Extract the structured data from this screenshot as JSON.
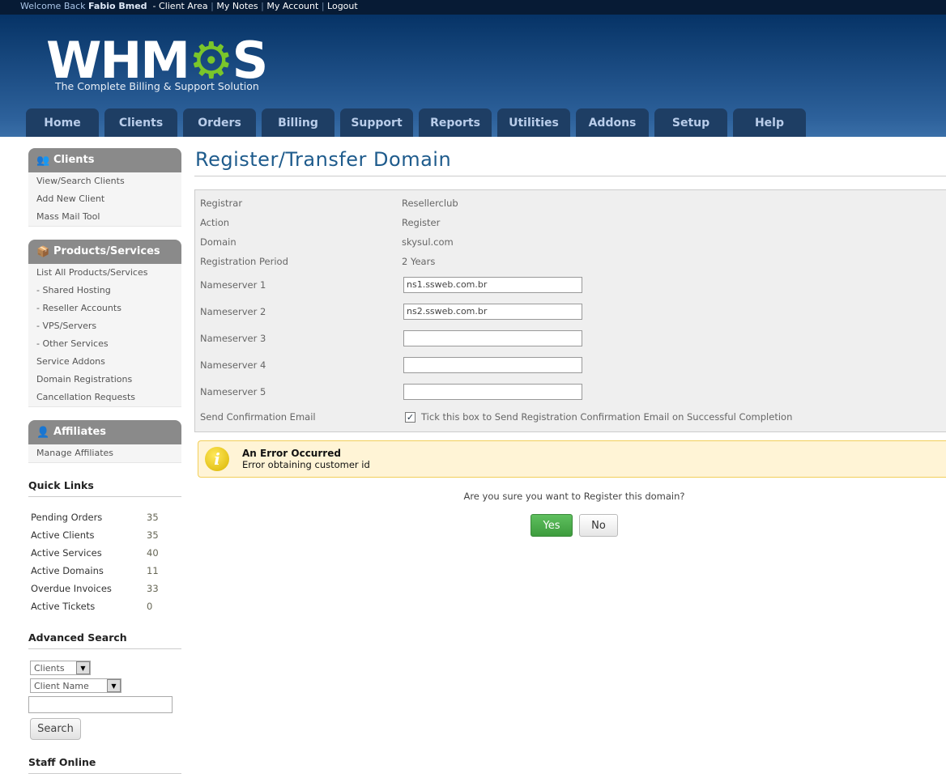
{
  "topbar": {
    "welcome": "Welcome Back",
    "user": "Fabio Bmed",
    "client_area": "Client Area",
    "my_notes": "My Notes",
    "my_account": "My Account",
    "logout": "Logout"
  },
  "logo": {
    "text": "WHMCS",
    "tagline": "The Complete Billing & Support Solution"
  },
  "nav": [
    "Home",
    "Clients",
    "Orders",
    "Billing",
    "Support",
    "Reports",
    "Utilities",
    "Addons",
    "Setup",
    "Help"
  ],
  "sidebar": {
    "clients": {
      "title": "Clients",
      "items": [
        "View/Search Clients",
        "Add New Client",
        "Mass Mail Tool"
      ]
    },
    "products": {
      "title": "Products/Services",
      "items": [
        "List All Products/Services",
        "- Shared Hosting",
        "- Reseller Accounts",
        "- VPS/Servers",
        "- Other Services",
        "Service Addons",
        "Domain Registrations",
        "Cancellation Requests"
      ]
    },
    "affiliates": {
      "title": "Affiliates",
      "items": [
        "Manage Affiliates"
      ]
    },
    "quick_links": {
      "title": "Quick Links",
      "items": [
        {
          "label": "Pending Orders",
          "count": "35"
        },
        {
          "label": "Active Clients",
          "count": "35"
        },
        {
          "label": "Active Services",
          "count": "40"
        },
        {
          "label": "Active Domains",
          "count": "11"
        },
        {
          "label": "Overdue Invoices",
          "count": "33"
        },
        {
          "label": "Active Tickets",
          "count": "0"
        }
      ]
    },
    "advanced_search": {
      "title": "Advanced Search",
      "type": "Clients",
      "field": "Client Name",
      "query": "",
      "button": "Search"
    },
    "staff_online": {
      "title": "Staff Online"
    }
  },
  "main": {
    "title": "Register/Transfer Domain",
    "info": [
      {
        "label": "Registrar",
        "value": "Resellerclub"
      },
      {
        "label": "Action",
        "value": "Register"
      },
      {
        "label": "Domain",
        "value": "skysul.com"
      },
      {
        "label": "Registration Period",
        "value": "2 Years"
      }
    ],
    "nameservers": [
      {
        "label": "Nameserver 1",
        "value": "ns1.ssweb.com.br"
      },
      {
        "label": "Nameserver 2",
        "value": "ns2.ssweb.com.br"
      },
      {
        "label": "Nameserver 3",
        "value": ""
      },
      {
        "label": "Nameserver 4",
        "value": ""
      },
      {
        "label": "Nameserver 5",
        "value": ""
      }
    ],
    "send_email": {
      "label": "Send Confirmation Email",
      "checked": true,
      "text": "Tick this box to Send Registration Confirmation Email on Successful Completion"
    },
    "error": {
      "title": "An Error Occurred",
      "message": "Error obtaining customer id"
    },
    "confirm": "Are you sure you want to Register this domain?",
    "yes": "Yes",
    "no": "No"
  },
  "colors": {
    "accent": "#1e5b8c",
    "nav_tab": "#1e3e64",
    "yes_button": "#4cae4c",
    "error_bg": "#fff4d6"
  }
}
